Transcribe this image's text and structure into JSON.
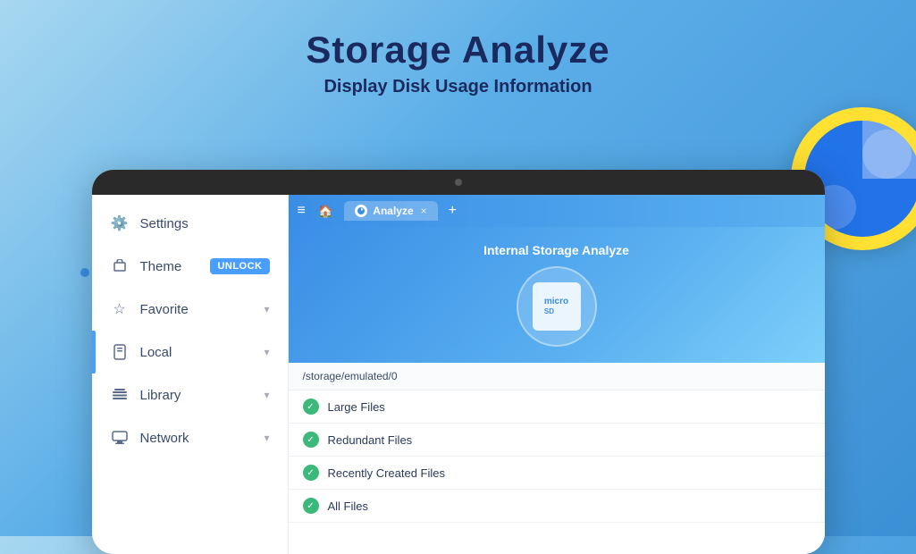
{
  "header": {
    "title": "Storage Analyze",
    "subtitle": "Display Disk Usage Information"
  },
  "sidebar": {
    "items": [
      {
        "id": "settings",
        "label": "Settings",
        "icon": "⚙",
        "badge": null,
        "chevron": false
      },
      {
        "id": "theme",
        "label": "Theme",
        "icon": "👕",
        "badge": "UNLOCK",
        "chevron": false
      },
      {
        "id": "favorite",
        "label": "Favorite",
        "icon": "★",
        "badge": null,
        "chevron": "▾"
      },
      {
        "id": "local",
        "label": "Local",
        "icon": "📱",
        "badge": null,
        "chevron": "▾",
        "active": true
      },
      {
        "id": "library",
        "label": "Library",
        "icon": "📚",
        "badge": null,
        "chevron": "▾"
      },
      {
        "id": "network",
        "label": "Network",
        "icon": "🏠",
        "badge": null,
        "chevron": "▾"
      }
    ]
  },
  "tabs": {
    "items": [
      {
        "label": "Analyze",
        "active": true
      }
    ],
    "plus_label": "+"
  },
  "analyze": {
    "title": "Internal Storage Analyze",
    "path": "/storage/emulated/0",
    "files": [
      {
        "label": "Large Files"
      },
      {
        "label": "Redundant Files"
      },
      {
        "label": "Recently Created Files"
      },
      {
        "label": "All Files"
      }
    ]
  },
  "icons": {
    "check": "✓",
    "menu": "≡",
    "home": "🏠",
    "close": "×"
  }
}
